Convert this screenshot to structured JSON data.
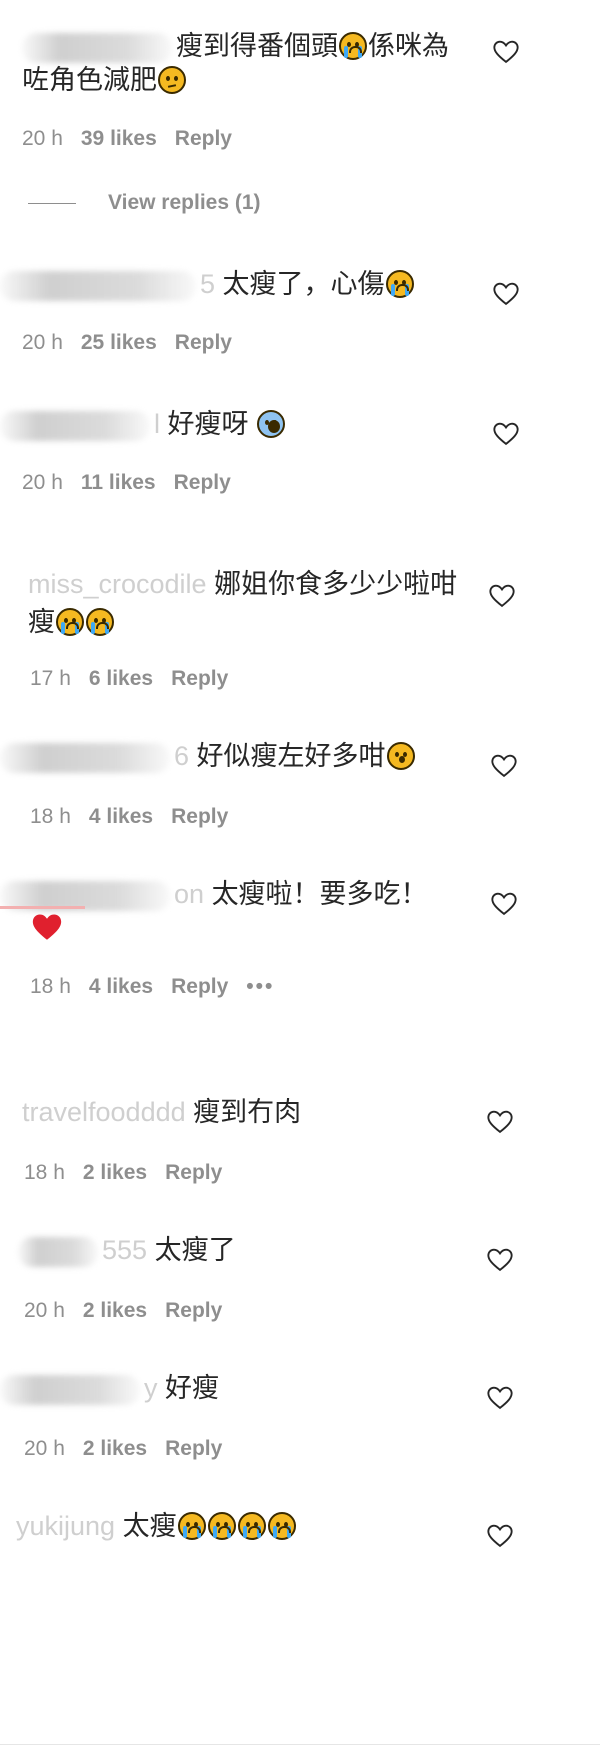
{
  "comments": [
    {
      "username": "szzy",
      "text_line1": "瘦到得番個頭",
      "text_line1b": "係咪為",
      "text_line2": "咗角色減肥",
      "time": "20 h",
      "likes": "39 likes",
      "reply": "Reply",
      "view_replies": "View replies (1)"
    },
    {
      "username": "5",
      "text": "太瘦了，心傷",
      "time": "20 h",
      "likes": "25 likes",
      "reply": "Reply"
    },
    {
      "username": "l",
      "text": "好瘦呀",
      "time": "20 h",
      "likes": "11 likes",
      "reply": "Reply"
    },
    {
      "username": "miss_crocodile",
      "text_line1": "娜姐你食多少少啦咁",
      "text_line2": "瘦",
      "time": "17 h",
      "likes": "6 likes",
      "reply": "Reply"
    },
    {
      "username": "6",
      "text": "好似瘦左好多咁",
      "time": "18 h",
      "likes": "4 likes",
      "reply": "Reply"
    },
    {
      "username": "on",
      "text": "太瘦啦！要多吃！",
      "time": "18 h",
      "likes": "4 likes",
      "reply": "Reply",
      "more": "•••"
    },
    {
      "username": "travelfoodddd",
      "text": "瘦到冇肉",
      "time": "18 h",
      "likes": "2 likes",
      "reply": "Reply"
    },
    {
      "username": "555",
      "text": "太瘦了",
      "time": "20 h",
      "likes": "2 likes",
      "reply": "Reply"
    },
    {
      "username": "y",
      "text": "好瘦",
      "time": "20 h",
      "likes": "2 likes",
      "reply": "Reply"
    },
    {
      "username": "yukijung",
      "text": "太瘦"
    }
  ],
  "icons": {
    "like": "heart-outline-icon",
    "red_heart": "red-heart-emoji"
  },
  "colors": {
    "text": "#262626",
    "meta": "#8e8e8e",
    "heart_red": "#e0202e"
  }
}
